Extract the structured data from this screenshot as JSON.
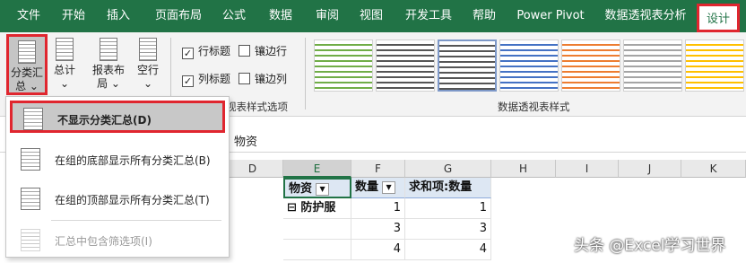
{
  "tabs": [
    "文件",
    "开始",
    "插入",
    "页面布局",
    "公式",
    "数据",
    "审阅",
    "视图",
    "开发工具",
    "帮助",
    "Power Pivot",
    "数据透视表分析",
    "设计"
  ],
  "ribbon": {
    "subtotal_label": "分类汇\n总 ⌄",
    "grandtotal_label": "总计\n⌄",
    "report_layout_label": "报表布\n局 ⌄",
    "blank_rows_label": "空行\n⌄",
    "row_headers": "行标题",
    "col_headers": "列标题",
    "banded_rows": "镶边行",
    "banded_cols": "镶边列",
    "row_headers_checked": true,
    "col_headers_checked": true,
    "style_options_group": "视表样式选项",
    "styles_group": "数据透视表样式",
    "swatch_colors": [
      "#70ad47",
      "#555555",
      "#555555",
      "#4472c4",
      "#ed7d31",
      "#a5a5a5",
      "#ffc000",
      "#5b9bd5"
    ]
  },
  "formula_bar": {
    "value": "物资"
  },
  "columns": [
    "D",
    "E",
    "F",
    "G",
    "H",
    "I",
    "J",
    "K"
  ],
  "active_column": "E",
  "pivot": {
    "headers": [
      "物资",
      "数量",
      "求和项:数量"
    ],
    "rows": [
      [
        "⊟ 防护服",
        "1",
        "1"
      ],
      [
        "",
        "3",
        "3"
      ],
      [
        "",
        "4",
        "4"
      ]
    ]
  },
  "dropdown": {
    "items": [
      {
        "label": "不显示分类汇总(D)",
        "selected": true,
        "disabled": false
      },
      {
        "label": "在组的底部显示所有分类汇总(B)",
        "selected": false,
        "disabled": false
      },
      {
        "label": "在组的顶部显示所有分类汇总(T)",
        "selected": false,
        "disabled": false
      },
      {
        "label": "汇总中包含筛选项(I)",
        "selected": false,
        "disabled": true
      }
    ]
  },
  "watermark": "头条 @Excel学习世界"
}
